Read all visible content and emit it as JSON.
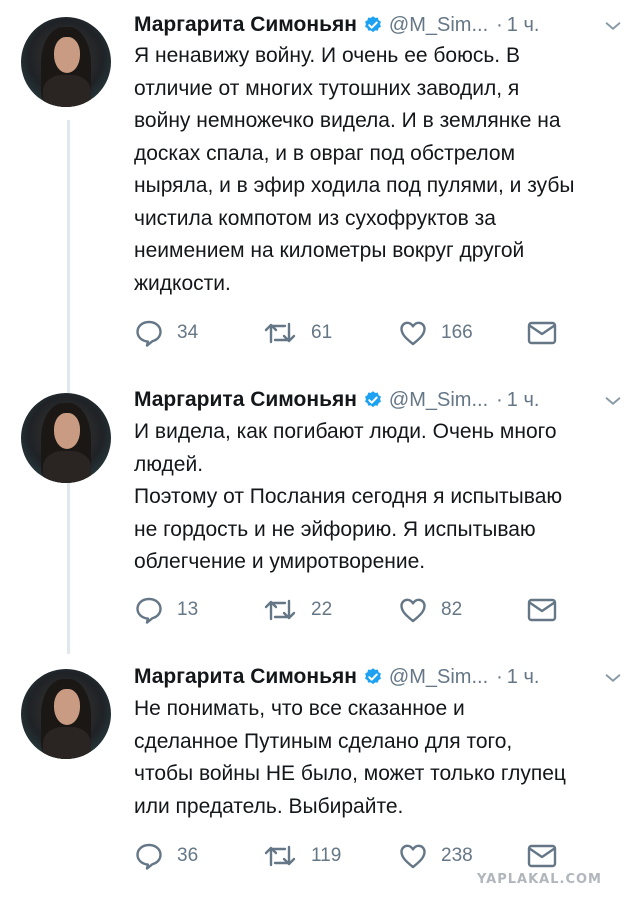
{
  "tweets": [
    {
      "name": "Маргарита Симоньян",
      "handle": "@M_Sim...",
      "dot": "·",
      "time": "1 ч.",
      "text": "Я ненавижу войну. И очень ее боюсь. В\nотличие от многих тутошних заводил, я\nвойну немножечко видела. И в землянке на\nдосках спала, и в овраг под обстрелом\nныряла, и в эфир ходила под пулями, и зубы\nчистила компотом из сухофруктов за\nнеимением на километры вокруг другой\nжидкости.",
      "replies": "34",
      "retweets": "61",
      "likes": "166"
    },
    {
      "name": "Маргарита Симоньян",
      "handle": "@M_Sim...",
      "dot": "·",
      "time": "1 ч.",
      "text": "И видела, как погибают люди. Очень много\nлюдей.\nПоэтому от Послания сегодня я испытываю\nне гордость и не эйфорию. Я испытываю\nоблегчение и умиротворение.",
      "replies": "13",
      "retweets": "22",
      "likes": "82"
    },
    {
      "name": "Маргарита Симоньян",
      "handle": "@M_Sim...",
      "dot": "·",
      "time": "1 ч.",
      "text": "Не понимать, что все сказанное и\nсделанное Путиным сделано для того,\nчтобы войны НЕ было, может только глупец\nили предатель. Выбирайте.",
      "replies": "36",
      "retweets": "119",
      "likes": "238"
    }
  ],
  "watermark": "YAPLAKAL.COM",
  "icons": {
    "verified": "verified-badge-icon",
    "more": "chevron-down-icon",
    "reply": "reply-bubble-icon",
    "retweet": "retweet-arrows-icon",
    "like": "heart-outline-icon",
    "dm": "envelope-icon"
  },
  "colors": {
    "text": "#14171a",
    "secondary": "#657786",
    "verified": "#1da1f2",
    "thread_line": "#e1e8ed"
  }
}
